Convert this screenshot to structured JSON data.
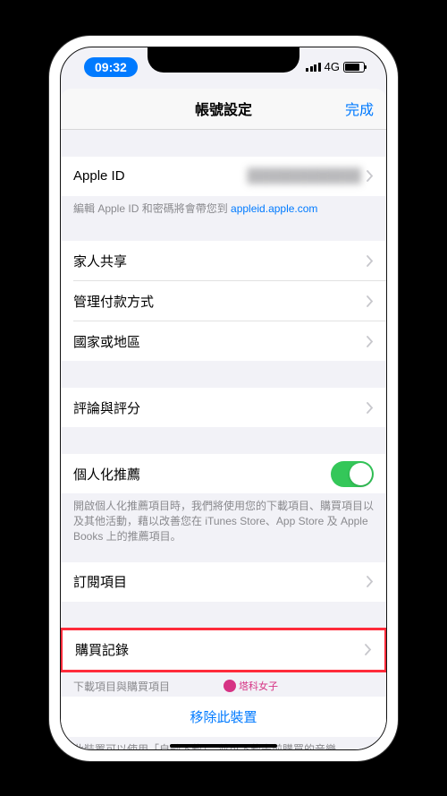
{
  "status": {
    "time": "09:32",
    "network": "4G"
  },
  "header": {
    "title": "帳號設定",
    "done": "完成"
  },
  "account": {
    "label": "Apple ID",
    "value": "████████████",
    "footer_prefix": "編輯 Apple ID 和密碼將會帶您到 ",
    "footer_link": "appleid.apple.com"
  },
  "rows": {
    "family_sharing": "家人共享",
    "payment": "管理付款方式",
    "country": "國家或地區",
    "ratings": "評論與評分",
    "personalized": "個人化推薦",
    "personalized_footer": "開啟個人化推薦項目時，我們將使用您的下載項目、購買項目以及其他活動，藉以改善您在 iTunes Store、App Store 及 Apple Books 上的推薦項目。",
    "subscriptions": "訂閱項目",
    "purchase_history": "購買記錄"
  },
  "bottom": {
    "sub_label": "下載項目與購買項目",
    "watermark": "塔科女子",
    "remove_device": "移除此裝置",
    "device_footer": "此裝置可以使用「自動下載」，並可下載先前購買的音樂、App、影片和書籍"
  }
}
